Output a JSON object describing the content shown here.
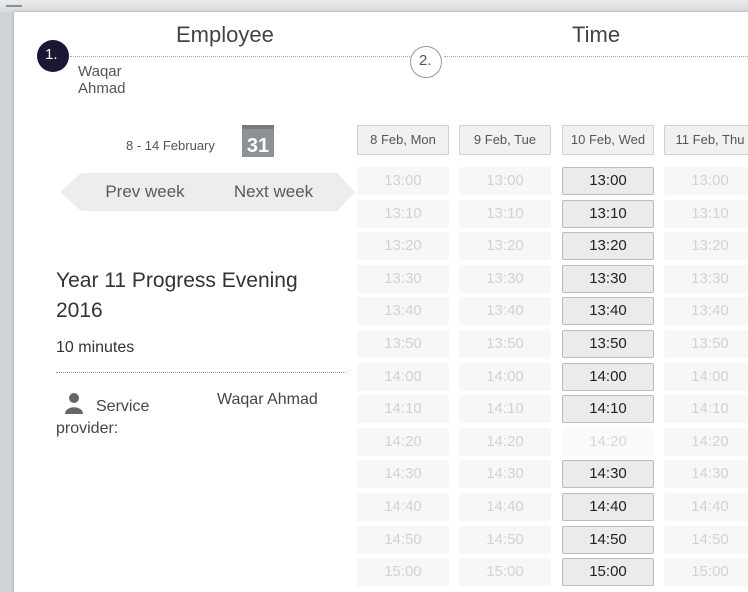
{
  "steps": [
    {
      "number": "1.",
      "title": "Employee",
      "subtitle": "Waqar Ahmad"
    },
    {
      "number": "2.",
      "title": "Time"
    }
  ],
  "week": {
    "range": "8 - 14 February",
    "calendar_day": "31",
    "prev_label": "Prev week",
    "next_label": "Next week"
  },
  "service": {
    "title": "Year 11 Progress Evening 2016",
    "duration": "10 minutes",
    "provider_label": "Service provider:",
    "provider_name": "Waqar Ahmad"
  },
  "schedule": {
    "days": [
      "8 Feb, Mon",
      "9 Feb, Tue",
      "10 Feb, Wed",
      "11 Feb, Thu"
    ],
    "times": [
      "13:00",
      "13:10",
      "13:20",
      "13:30",
      "13:40",
      "13:50",
      "14:00",
      "14:10",
      "14:20",
      "14:30",
      "14:40",
      "14:50",
      "15:00"
    ],
    "available": [
      [
        false,
        false,
        false,
        false,
        false,
        false,
        false,
        false,
        false,
        false,
        false,
        false,
        false
      ],
      [
        false,
        false,
        false,
        false,
        false,
        false,
        false,
        false,
        false,
        false,
        false,
        false,
        false
      ],
      [
        true,
        true,
        true,
        true,
        true,
        true,
        true,
        true,
        false,
        true,
        true,
        true,
        true
      ],
      [
        false,
        false,
        false,
        false,
        false,
        false,
        false,
        false,
        false,
        false,
        false,
        false,
        false
      ]
    ]
  },
  "colors": {
    "step_active": "#1c1533",
    "slot_available": "#ebebeb",
    "slot_unavailable": "#f7f7f7"
  }
}
